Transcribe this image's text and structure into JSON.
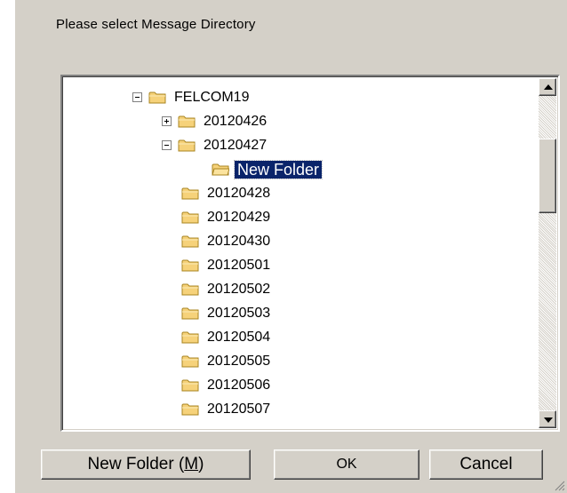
{
  "prompt": "Please select  Message Directory",
  "tree": {
    "nodes": [
      {
        "label": "FELCOM19",
        "expander": "minus",
        "selected": false
      },
      {
        "label": "20120426",
        "expander": "plus",
        "selected": false
      },
      {
        "label": "20120427",
        "expander": "minus",
        "selected": false
      },
      {
        "label": "New Folder",
        "expander": "none",
        "selected": true
      },
      {
        "label": "20120428",
        "expander": "none",
        "selected": false
      },
      {
        "label": "20120429",
        "expander": "none",
        "selected": false
      },
      {
        "label": "20120430",
        "expander": "none",
        "selected": false
      },
      {
        "label": "20120501",
        "expander": "none",
        "selected": false
      },
      {
        "label": "20120502",
        "expander": "none",
        "selected": false
      },
      {
        "label": "20120503",
        "expander": "none",
        "selected": false
      },
      {
        "label": "20120504",
        "expander": "none",
        "selected": false
      },
      {
        "label": "20120505",
        "expander": "none",
        "selected": false
      },
      {
        "label": "20120506",
        "expander": "none",
        "selected": false
      },
      {
        "label": "20120507",
        "expander": "none",
        "selected": false
      }
    ]
  },
  "buttons": {
    "new_folder": {
      "text": "New Folder (",
      "mnemonic": "M",
      "suffix": ")"
    },
    "ok": "OK",
    "cancel": "Cancel"
  },
  "colors": {
    "dialog_bg": "#d4d0c8",
    "selection_bg": "#0a246a",
    "folder_fill": "#f6d27a"
  },
  "icons": {
    "folder": "folder-icon",
    "expand": "plus-box-icon",
    "collapse": "minus-box-icon",
    "scroll_up": "triangle-up-icon",
    "scroll_down": "triangle-down-icon"
  }
}
